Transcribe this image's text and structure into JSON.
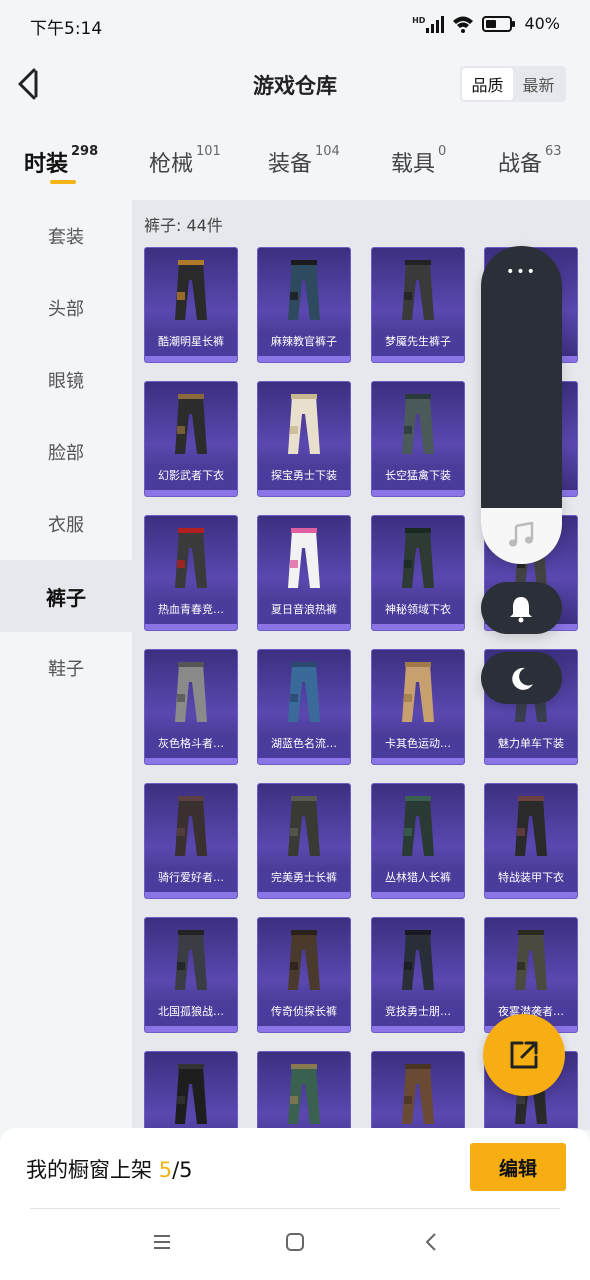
{
  "status": {
    "time": "下午5:14",
    "battery": "40%",
    "net": "HD"
  },
  "header": {
    "title": "游戏仓库",
    "sort": [
      "品质",
      "最新"
    ],
    "active_sort": 0
  },
  "tabs": [
    {
      "label": "时装",
      "count": "298"
    },
    {
      "label": "枪械",
      "count": "101"
    },
    {
      "label": "装备",
      "count": "104"
    },
    {
      "label": "载具",
      "count": "0"
    },
    {
      "label": "战备",
      "count": "63"
    }
  ],
  "side": [
    "套装",
    "头部",
    "眼镜",
    "脸部",
    "衣服",
    "裤子",
    "鞋子"
  ],
  "active_side": 5,
  "content": {
    "count_label": "裤子: 44件"
  },
  "items": [
    {
      "name": "酷潮明星长裤",
      "color": "#2a2a2a",
      "accent": "#b07a2a"
    },
    {
      "name": "麻辣教官裤子",
      "color": "#2e4a5e",
      "accent": "#1b1b1b"
    },
    {
      "name": "梦魇先生裤子",
      "color": "#3a3a3a",
      "accent": "#222"
    },
    {
      "name": "",
      "color": "#555",
      "accent": "#333"
    },
    {
      "name": "幻影武者下衣",
      "color": "#2c2c2c",
      "accent": "#8a6a3a"
    },
    {
      "name": "探宝勇士下装",
      "color": "#e8e0cc",
      "accent": "#c8b890"
    },
    {
      "name": "长空猛禽下装",
      "color": "#4a5a5a",
      "accent": "#2a3a3a"
    },
    {
      "name": "",
      "color": "#555",
      "accent": "#333"
    },
    {
      "name": "热血青春竞…",
      "color": "#3a3a3a",
      "accent": "#b02020"
    },
    {
      "name": "夏日音浪热裤",
      "color": "#f2f2f2",
      "accent": "#e060a0"
    },
    {
      "name": "神秘领域下衣",
      "color": "#2e3a34",
      "accent": "#1a2a22"
    },
    {
      "name": "",
      "color": "#444",
      "accent": "#222"
    },
    {
      "name": "灰色格斗者…",
      "color": "#8a8a8a",
      "accent": "#555"
    },
    {
      "name": "湖蓝色名流…",
      "color": "#3a6a9a",
      "accent": "#2a4a70"
    },
    {
      "name": "卡其色运动…",
      "color": "#c8a070",
      "accent": "#a07a4a"
    },
    {
      "name": "魅力单车下装",
      "color": "#3a4050",
      "accent": "#222"
    },
    {
      "name": "骑行爱好者…",
      "color": "#3a3030",
      "accent": "#5a4040"
    },
    {
      "name": "完美勇士长裤",
      "color": "#3a3a34",
      "accent": "#5a5a50"
    },
    {
      "name": "丛林猎人长裤",
      "color": "#2a3a34",
      "accent": "#3a6050"
    },
    {
      "name": "特战装甲下衣",
      "color": "#2a2a2a",
      "accent": "#6a4040"
    },
    {
      "name": "北国孤狼战…",
      "color": "#3a3e44",
      "accent": "#222"
    },
    {
      "name": "传奇侦探长裤",
      "color": "#4a3a2e",
      "accent": "#2a221a"
    },
    {
      "name": "竞技勇士朋…",
      "color": "#2a2e38",
      "accent": "#1a1a22"
    },
    {
      "name": "夜雾潜袭者…",
      "color": "#4a4a3e",
      "accent": "#2a2a20"
    },
    {
      "name": "",
      "color": "#1e1e1e",
      "accent": "#333"
    },
    {
      "name": "",
      "color": "#3a6050",
      "accent": "#8a7a50"
    },
    {
      "name": "",
      "color": "#6a4a34",
      "accent": "#4a3424"
    },
    {
      "name": "",
      "color": "#2a2a2a",
      "accent": "#444"
    }
  ],
  "bottom": {
    "label": "我的橱窗上架 ",
    "current": "5",
    "total": "/5",
    "edit": "编辑"
  }
}
